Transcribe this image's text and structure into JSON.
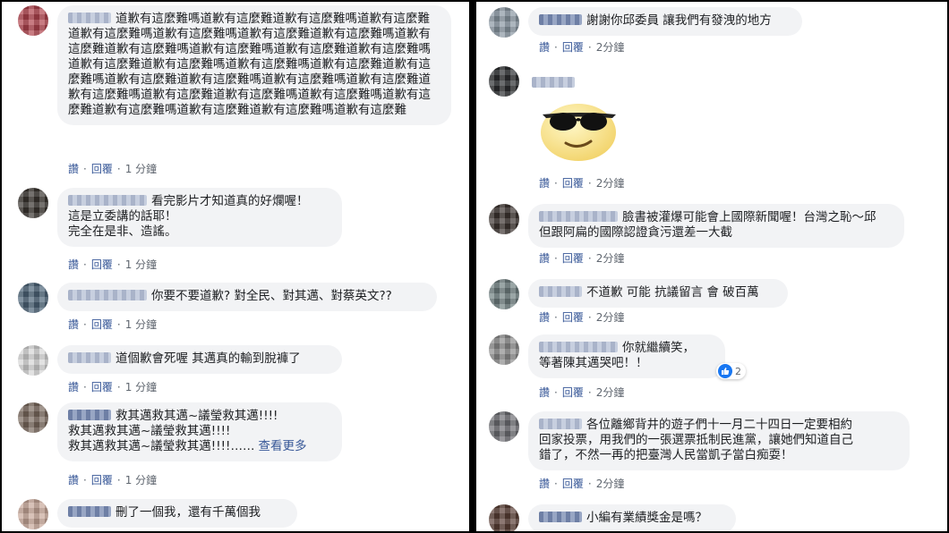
{
  "left_comments": [
    {
      "text": "道歉有這麼難嗎道歉有這麼難道歉有這麼難嗎道歉有這麼難道歉有這麼難嗎道歉有這麼難嗎道歉有這麼難道歉有這麼難嗎道歉有這麼難道歉有這麼難嗎道歉有這麼難嗎道歉有這麼難道歉有這麼難嗎道歉有這麼難道歉有這麼難嗎道歉有這麼難嗎道歉有這麼難道歉有這麼難嗎道歉有這麼難道歉有這麼難嗎道歉有這麼難嗎道歉有這麼難道歉有這麼難嗎道歉有這麼難道歉有這麼難嗎道歉有這麼難嗎道歉有這麼難道歉有這麼難嗎道歉有這麼難道歉有這麼難嗎道歉有這麼難",
      "like": "讚",
      "reply": "回覆",
      "time": "1 分鐘"
    },
    {
      "text": "看完影片才知道真的好爛喔！\n這是立委講的話耶！\n完全在是非、造謠。",
      "like": "讚",
      "reply": "回覆",
      "time": "1 分鐘"
    },
    {
      "text": "你要不要道歉? 對全民、對其邁、對蔡英文??",
      "like": "讚",
      "reply": "回覆",
      "time": "1 分鐘"
    },
    {
      "text": "道個歉會死喔 其邁真的輸到脫褲了",
      "like": "讚",
      "reply": "回覆",
      "time": "1 分鐘"
    },
    {
      "text": "救其邁救其邁~議瑩救其邁!!!!\n救其邁救其邁~議瑩救其邁!!!!\n救其邁救其邁~議瑩救其邁!!!!……",
      "see_more": "查看更多",
      "like": "讚",
      "reply": "回覆",
      "time": "1 分鐘"
    },
    {
      "text": "刪了一個我，還有千萬個我"
    }
  ],
  "right_comments": [
    {
      "text": "謝謝你邱委員 讓我們有發洩的地方",
      "like": "讚",
      "reply": "回覆",
      "time": "2分鐘"
    },
    {
      "text": "",
      "sticker": "cool-sunglasses-face",
      "like": "讚",
      "reply": "回覆",
      "time": "2分鐘"
    },
    {
      "text": "臉書被灌爆可能會上國際新聞喔！台灣之恥～邱\n但跟阿扁的國際認證貪污還差一大截",
      "like": "讚",
      "reply": "回覆",
      "time": "2分鐘"
    },
    {
      "text": "不道歉 可能 抗議留言 會 破百萬",
      "like": "讚",
      "reply": "回覆",
      "time": "2分鐘"
    },
    {
      "text": "你就繼續笑，\n等著陳其邁哭吧！！",
      "reactions": "2",
      "like": "讚",
      "reply": "回覆",
      "time": "2分鐘"
    },
    {
      "text": "各位離鄉背井的遊子們十一月二十四日一定要相約\n回家投票，用我們的一張選票抵制民進黨，讓她們知道自己\n錯了，不然一再的把臺灣人民當凱子當白痴耍！",
      "like": "讚",
      "reply": "回覆",
      "time": "2分鐘"
    },
    {
      "text": "小編有業績獎金是嗎？"
    }
  ],
  "colors": {
    "bubble_bg": "#f2f3f5",
    "link_blue": "#385898",
    "like_blue": "#1877f2",
    "text": "#1c1e21",
    "meta": "#606770"
  }
}
